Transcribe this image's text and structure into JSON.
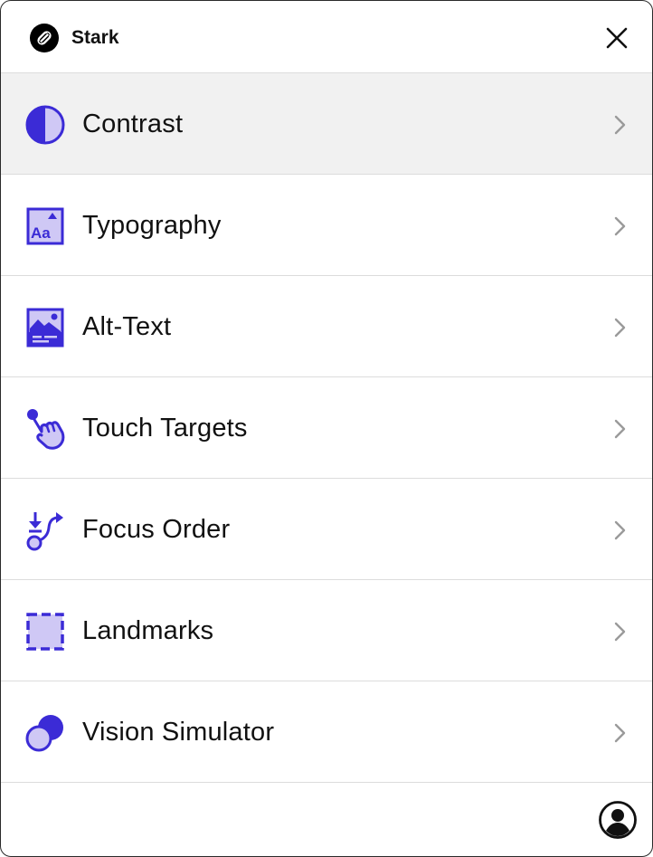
{
  "app": {
    "title": "Stark",
    "logo_icon": "stark-logo-icon",
    "close_icon": "close-icon",
    "accent_color": "#3b2bd6",
    "accent_light": "#cfc8f5"
  },
  "menu": {
    "items": [
      {
        "label": "Contrast",
        "icon": "contrast-icon",
        "active": true
      },
      {
        "label": "Typography",
        "icon": "typography-icon",
        "active": false
      },
      {
        "label": "Alt-Text",
        "icon": "alt-text-icon",
        "active": false
      },
      {
        "label": "Touch Targets",
        "icon": "touch-targets-icon",
        "active": false
      },
      {
        "label": "Focus Order",
        "icon": "focus-order-icon",
        "active": false
      },
      {
        "label": "Landmarks",
        "icon": "landmarks-icon",
        "active": false
      },
      {
        "label": "Vision Simulator",
        "icon": "vision-simulator-icon",
        "active": false
      }
    ]
  },
  "footer": {
    "account_icon": "account-icon"
  }
}
